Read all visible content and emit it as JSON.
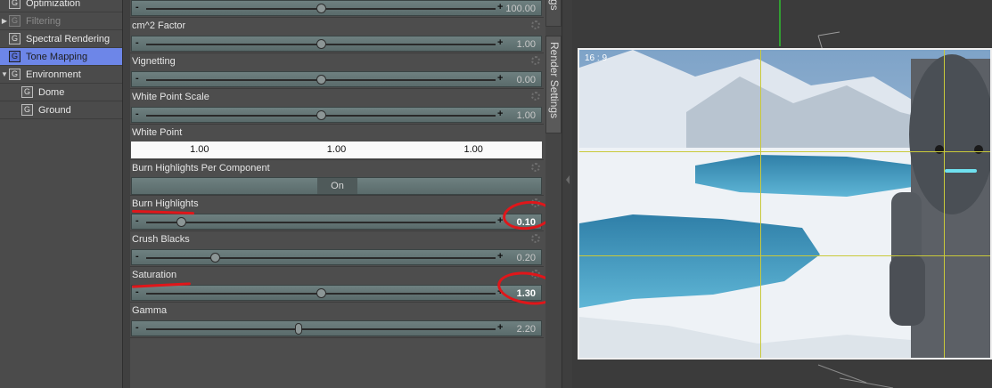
{
  "tree": {
    "items": [
      {
        "label": "Optimization",
        "icon": "G",
        "expander": "",
        "state": "normal"
      },
      {
        "label": "Filtering",
        "icon": "G",
        "expander": "▶",
        "state": "disabled"
      },
      {
        "label": "Spectral Rendering",
        "icon": "G",
        "expander": "",
        "state": "normal"
      },
      {
        "label": "Tone Mapping",
        "icon": "G",
        "expander": "",
        "state": "selected"
      },
      {
        "label": "Environment",
        "icon": "G",
        "expander": "▼",
        "state": "normal"
      },
      {
        "label": "Dome",
        "icon": "G",
        "expander": "",
        "state": "child"
      },
      {
        "label": "Ground",
        "icon": "G",
        "expander": "",
        "state": "child"
      }
    ]
  },
  "properties": {
    "top_slider_value": "100.00",
    "items": [
      {
        "label": "cm^2 Factor",
        "value": "1.00",
        "fraction": 0.5
      },
      {
        "label": "Vignetting",
        "value": "0.00",
        "fraction": 0.5
      },
      {
        "label": "White Point Scale",
        "value": "1.00",
        "fraction": 0.5
      },
      {
        "label": "White Point",
        "values": [
          "1.00",
          "1.00",
          "1.00"
        ]
      },
      {
        "label": "Burn Highlights Per Component",
        "toggle": "On"
      },
      {
        "label": "Burn Highlights",
        "value": "0.10",
        "fraction": 0.1
      },
      {
        "label": "Crush Blacks",
        "value": "0.20",
        "fraction": 0.2
      },
      {
        "label": "Saturation",
        "value": "1.30",
        "fraction": 0.5
      },
      {
        "label": "Gamma",
        "value": "2.20",
        "fraction": 0.44
      }
    ]
  },
  "tabs": {
    "render_settings": "Render Settings",
    "top_partial": "gs"
  },
  "viewport": {
    "aspect_label": "16 : 9"
  },
  "colors": {
    "selection": "#6d86e8",
    "annotation": "#e0161a",
    "guides": "#c9c93a"
  }
}
